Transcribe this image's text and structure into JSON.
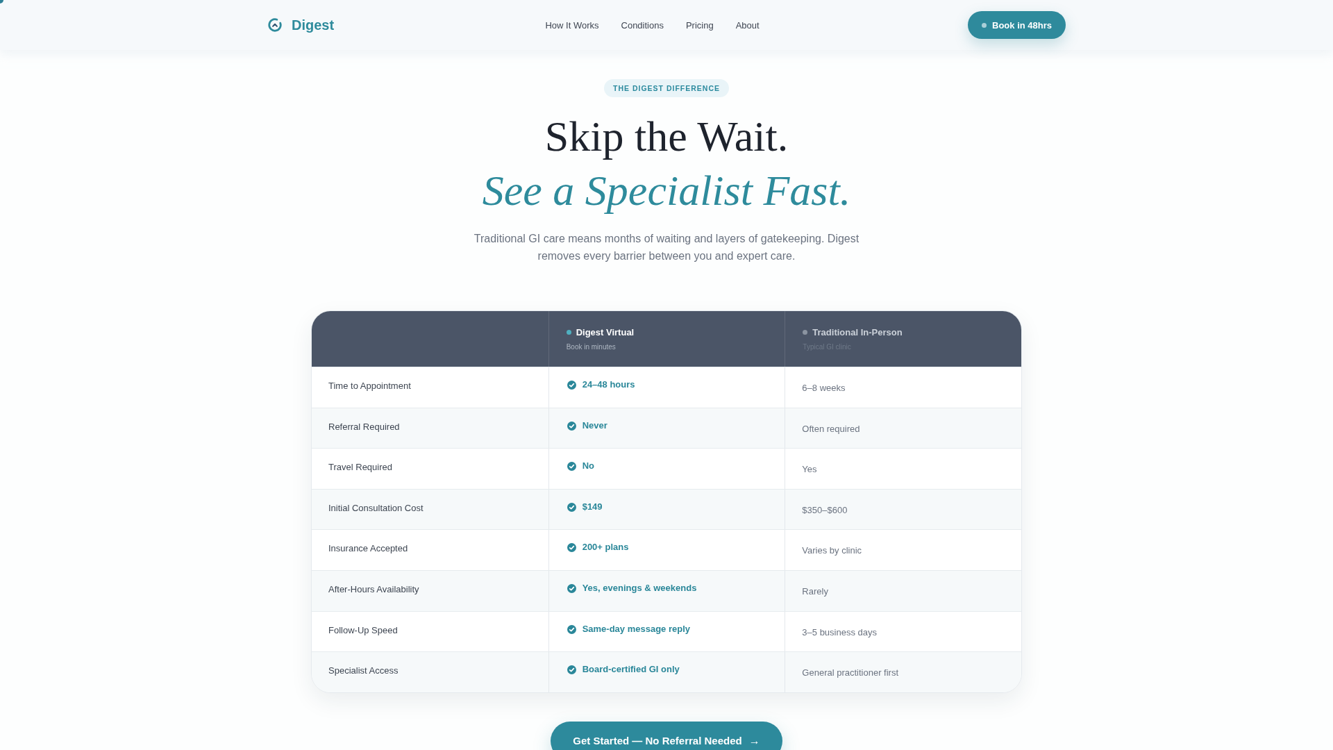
{
  "nav": {
    "logo": "Digest",
    "links": [
      "How It Works",
      "Conditions",
      "Pricing",
      "About"
    ],
    "cta": "Book in 48hrs"
  },
  "hero": {
    "badge": "THE DIGEST DIFFERENCE",
    "title": "Skip the Wait.",
    "title_accent": "See a Specialist Fast.",
    "subtitle": "Traditional GI care means months of waiting and layers of gatekeeping. Digest removes every barrier between you and expert care."
  },
  "comparison": {
    "columns": [
      {
        "name": "Digest Virtual",
        "note": "Book in minutes",
        "color": "#4fb0c0",
        "kind": "featured"
      },
      {
        "name": "Traditional In-Person",
        "note": "Typical GI clinic",
        "color": "#8b94a1",
        "kind": "standard"
      }
    ],
    "rows": [
      {
        "feature": "Time to Appointment",
        "values": [
          "24–48 hours",
          "6–8 weeks"
        ]
      },
      {
        "feature": "Referral Required",
        "values": [
          "Never",
          "Often required"
        ]
      },
      {
        "feature": "Travel Required",
        "values": [
          "No",
          "Yes"
        ]
      },
      {
        "feature": "Initial Consultation Cost",
        "values": [
          "$149",
          "$350–$600"
        ]
      },
      {
        "feature": "Insurance Accepted",
        "values": [
          "200+ plans",
          "Varies by clinic"
        ]
      },
      {
        "feature": "After-Hours Availability",
        "values": [
          "Yes, evenings & weekends",
          "Rarely"
        ]
      },
      {
        "feature": "Follow-Up Speed",
        "values": [
          "Same-day message reply",
          "3–5 business days"
        ]
      },
      {
        "feature": "Specialist Access",
        "values": [
          "Board-certified GI only",
          "General practitioner first"
        ]
      }
    ]
  },
  "cta": {
    "label": "Get Started — No Referral Needed",
    "arrow": "→"
  }
}
